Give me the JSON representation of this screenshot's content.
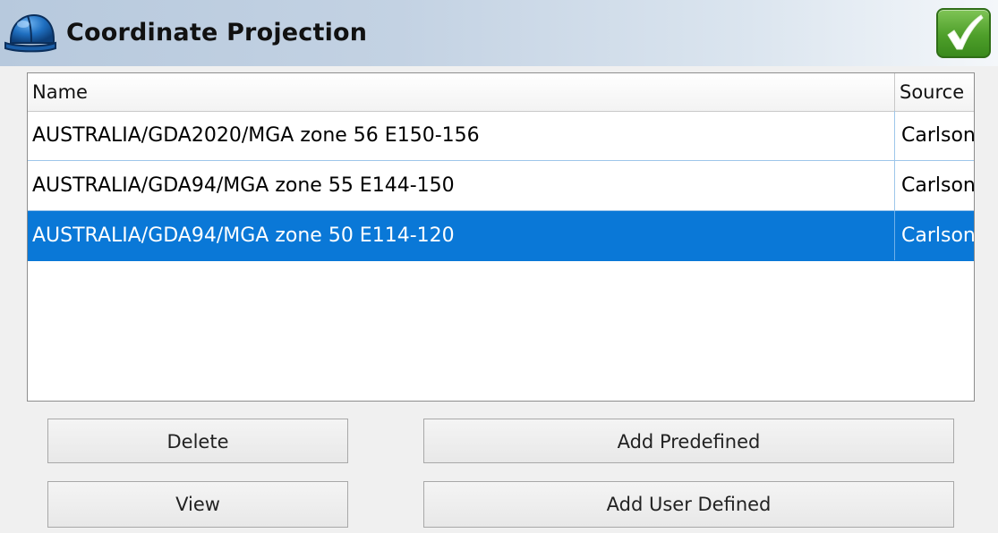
{
  "window": {
    "title": "Coordinate Projection"
  },
  "icons": {
    "app": "hard-hat-icon",
    "confirm": "checkmark-icon"
  },
  "table": {
    "columns": {
      "name": "Name",
      "source": "Source"
    },
    "rows": [
      {
        "name": "AUSTRALIA/GDA2020/MGA zone 56 E150-156",
        "source": "Carlson",
        "selected": false
      },
      {
        "name": "AUSTRALIA/GDA94/MGA zone 55 E144-150",
        "source": "Carlson",
        "selected": false
      },
      {
        "name": "AUSTRALIA/GDA94/MGA zone 50 E114-120",
        "source": "Carlson",
        "selected": true
      }
    ]
  },
  "buttons": {
    "delete": "Delete",
    "view": "View",
    "add_predefined": "Add Predefined",
    "add_user_defined": "Add User Defined"
  },
  "colors": {
    "selection": "#0a78d7",
    "confirm_green": "#4e9f2a",
    "helmet_blue": "#1f6fc0"
  }
}
